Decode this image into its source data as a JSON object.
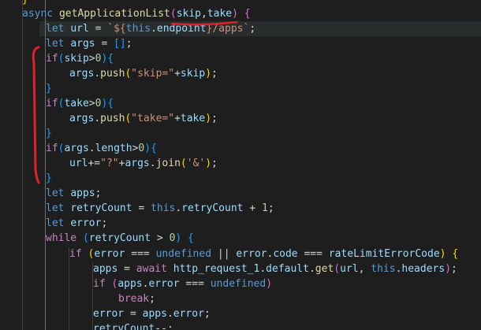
{
  "editor": {
    "language": "javascript",
    "theme": "dark",
    "colors": {
      "background": "#1e1e1e",
      "keyword": "#569cd6",
      "control": "#c586c0",
      "function": "#dcdcaa",
      "variable": "#9cdcfe",
      "string": "#ce9178",
      "number": "#b5cea8",
      "text": "#d4d4d4",
      "annotation": "#e0202a"
    },
    "lines": [
      {
        "tokens": [
          {
            "t": "}",
            "c": "brk1"
          }
        ]
      },
      {
        "tokens": [
          {
            "t": "async ",
            "c": "kw"
          },
          {
            "t": "getApplicationList",
            "c": "fn"
          },
          {
            "t": "(",
            "c": "brk2"
          },
          {
            "t": "skip",
            "c": "var"
          },
          {
            "t": ",",
            "c": "punc"
          },
          {
            "t": "take",
            "c": "var"
          },
          {
            "t": ")",
            "c": "brk2"
          },
          {
            "t": " ",
            "c": "punc"
          },
          {
            "t": "{",
            "c": "brk2"
          }
        ]
      },
      {
        "tokens": [
          {
            "t": "let ",
            "c": "kw"
          },
          {
            "t": "url",
            "c": "var"
          },
          {
            "t": " = ",
            "c": "punc"
          },
          {
            "t": "`${",
            "c": "str"
          },
          {
            "t": "this",
            "c": "kw"
          },
          {
            "t": ".",
            "c": "punc"
          },
          {
            "t": "endpoint",
            "c": "var"
          },
          {
            "t": "}/apps`",
            "c": "str"
          },
          {
            "t": ";",
            "c": "punc"
          }
        ]
      },
      {
        "tokens": [
          {
            "t": "let ",
            "c": "kw"
          },
          {
            "t": "args",
            "c": "var"
          },
          {
            "t": " = ",
            "c": "punc"
          },
          {
            "t": "[]",
            "c": "brk3"
          },
          {
            "t": ";",
            "c": "punc"
          }
        ]
      },
      {
        "tokens": [
          {
            "t": "if",
            "c": "ctrl"
          },
          {
            "t": "(",
            "c": "brk3"
          },
          {
            "t": "skip",
            "c": "var"
          },
          {
            "t": ">",
            "c": "punc"
          },
          {
            "t": "0",
            "c": "num"
          },
          {
            "t": ")",
            "c": "brk3"
          },
          {
            "t": "{",
            "c": "brk3"
          }
        ]
      },
      {
        "tokens": [
          {
            "t": "args",
            "c": "var"
          },
          {
            "t": ".",
            "c": "punc"
          },
          {
            "t": "push",
            "c": "fn"
          },
          {
            "t": "(",
            "c": "brk1"
          },
          {
            "t": "\"skip=\"",
            "c": "str"
          },
          {
            "t": "+",
            "c": "punc"
          },
          {
            "t": "skip",
            "c": "var"
          },
          {
            "t": ")",
            "c": "brk1"
          },
          {
            "t": ";",
            "c": "punc"
          }
        ]
      },
      {
        "tokens": [
          {
            "t": "}",
            "c": "brk3"
          }
        ]
      },
      {
        "tokens": [
          {
            "t": "if",
            "c": "ctrl"
          },
          {
            "t": "(",
            "c": "brk3"
          },
          {
            "t": "take",
            "c": "var"
          },
          {
            "t": ">",
            "c": "punc"
          },
          {
            "t": "0",
            "c": "num"
          },
          {
            "t": ")",
            "c": "brk3"
          },
          {
            "t": "{",
            "c": "brk3"
          }
        ]
      },
      {
        "tokens": [
          {
            "t": "args",
            "c": "var"
          },
          {
            "t": ".",
            "c": "punc"
          },
          {
            "t": "push",
            "c": "fn"
          },
          {
            "t": "(",
            "c": "brk1"
          },
          {
            "t": "\"take=\"",
            "c": "str"
          },
          {
            "t": "+",
            "c": "punc"
          },
          {
            "t": "take",
            "c": "var"
          },
          {
            "t": ")",
            "c": "brk1"
          },
          {
            "t": ";",
            "c": "punc"
          }
        ]
      },
      {
        "tokens": [
          {
            "t": "}",
            "c": "brk3"
          }
        ]
      },
      {
        "tokens": [
          {
            "t": "if",
            "c": "ctrl"
          },
          {
            "t": "(",
            "c": "brk3"
          },
          {
            "t": "args",
            "c": "var"
          },
          {
            "t": ".",
            "c": "punc"
          },
          {
            "t": "length",
            "c": "var"
          },
          {
            "t": ">",
            "c": "punc"
          },
          {
            "t": "0",
            "c": "num"
          },
          {
            "t": ")",
            "c": "brk3"
          },
          {
            "t": "{",
            "c": "brk3"
          }
        ]
      },
      {
        "tokens": [
          {
            "t": "url",
            "c": "var"
          },
          {
            "t": "+=",
            "c": "punc"
          },
          {
            "t": "\"?\"",
            "c": "str"
          },
          {
            "t": "+",
            "c": "punc"
          },
          {
            "t": "args",
            "c": "var"
          },
          {
            "t": ".",
            "c": "punc"
          },
          {
            "t": "join",
            "c": "fn"
          },
          {
            "t": "(",
            "c": "brk1"
          },
          {
            "t": "'&'",
            "c": "str"
          },
          {
            "t": ")",
            "c": "brk1"
          },
          {
            "t": ";",
            "c": "punc"
          }
        ]
      },
      {
        "tokens": [
          {
            "t": "}",
            "c": "brk3"
          }
        ]
      },
      {
        "tokens": [
          {
            "t": "let ",
            "c": "kw"
          },
          {
            "t": "apps",
            "c": "var"
          },
          {
            "t": ";",
            "c": "punc"
          }
        ]
      },
      {
        "tokens": [
          {
            "t": "let ",
            "c": "kw"
          },
          {
            "t": "retryCount",
            "c": "var"
          },
          {
            "t": " = ",
            "c": "punc"
          },
          {
            "t": "this",
            "c": "kw"
          },
          {
            "t": ".",
            "c": "punc"
          },
          {
            "t": "retryCount",
            "c": "var"
          },
          {
            "t": " + ",
            "c": "punc"
          },
          {
            "t": "1",
            "c": "num"
          },
          {
            "t": ";",
            "c": "punc"
          }
        ]
      },
      {
        "tokens": [
          {
            "t": "let ",
            "c": "kw"
          },
          {
            "t": "error",
            "c": "var"
          },
          {
            "t": ";",
            "c": "punc"
          }
        ]
      },
      {
        "tokens": [
          {
            "t": "while ",
            "c": "ctrl"
          },
          {
            "t": "(",
            "c": "brk3"
          },
          {
            "t": "retryCount",
            "c": "var"
          },
          {
            "t": " > ",
            "c": "punc"
          },
          {
            "t": "0",
            "c": "num"
          },
          {
            "t": ")",
            "c": "brk3"
          },
          {
            "t": " ",
            "c": "punc"
          },
          {
            "t": "{",
            "c": "brk3"
          }
        ]
      },
      {
        "tokens": [
          {
            "t": "if ",
            "c": "ctrl"
          },
          {
            "t": "(",
            "c": "brk1"
          },
          {
            "t": "error",
            "c": "var"
          },
          {
            "t": " === ",
            "c": "punc"
          },
          {
            "t": "undefined",
            "c": "kw"
          },
          {
            "t": " || ",
            "c": "punc"
          },
          {
            "t": "error",
            "c": "var"
          },
          {
            "t": ".",
            "c": "punc"
          },
          {
            "t": "code",
            "c": "var"
          },
          {
            "t": " === ",
            "c": "punc"
          },
          {
            "t": "rateLimitErrorCode",
            "c": "var"
          },
          {
            "t": ")",
            "c": "brk1"
          },
          {
            "t": " ",
            "c": "punc"
          },
          {
            "t": "{",
            "c": "brk1"
          }
        ]
      },
      {
        "tokens": [
          {
            "t": "apps",
            "c": "var"
          },
          {
            "t": " = ",
            "c": "punc"
          },
          {
            "t": "await ",
            "c": "ctrl"
          },
          {
            "t": "http_request_1",
            "c": "var"
          },
          {
            "t": ".",
            "c": "punc"
          },
          {
            "t": "default",
            "c": "var"
          },
          {
            "t": ".",
            "c": "punc"
          },
          {
            "t": "get",
            "c": "fn"
          },
          {
            "t": "(",
            "c": "brk2"
          },
          {
            "t": "url",
            "c": "var"
          },
          {
            "t": ", ",
            "c": "punc"
          },
          {
            "t": "this",
            "c": "kw"
          },
          {
            "t": ".",
            "c": "punc"
          },
          {
            "t": "headers",
            "c": "var"
          },
          {
            "t": ")",
            "c": "brk2"
          },
          {
            "t": ";",
            "c": "punc"
          }
        ]
      },
      {
        "tokens": [
          {
            "t": "if ",
            "c": "ctrl"
          },
          {
            "t": "(",
            "c": "brk2"
          },
          {
            "t": "apps",
            "c": "var"
          },
          {
            "t": ".",
            "c": "punc"
          },
          {
            "t": "error",
            "c": "var"
          },
          {
            "t": " === ",
            "c": "punc"
          },
          {
            "t": "undefined",
            "c": "kw"
          },
          {
            "t": ")",
            "c": "brk2"
          }
        ]
      },
      {
        "tokens": [
          {
            "t": "break",
            "c": "ctrl"
          },
          {
            "t": ";",
            "c": "punc"
          }
        ]
      },
      {
        "tokens": [
          {
            "t": "error",
            "c": "var"
          },
          {
            "t": " = ",
            "c": "punc"
          },
          {
            "t": "apps",
            "c": "var"
          },
          {
            "t": ".",
            "c": "punc"
          },
          {
            "t": "error",
            "c": "var"
          },
          {
            "t": ";",
            "c": "punc"
          }
        ]
      },
      {
        "tokens": [
          {
            "t": "retryCount",
            "c": "var"
          },
          {
            "t": "--",
            "c": "punc"
          },
          {
            "t": ";",
            "c": "punc"
          }
        ]
      }
    ]
  }
}
